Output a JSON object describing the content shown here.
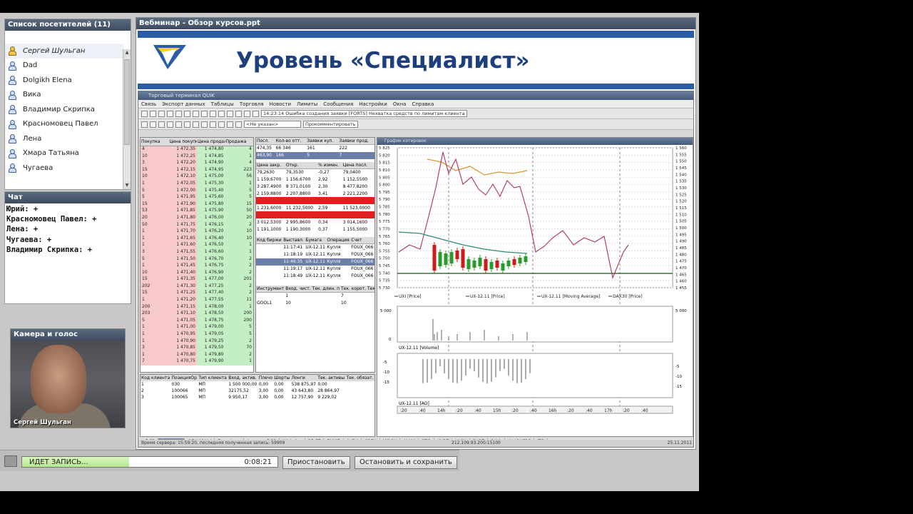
{
  "attendees": {
    "title": "Список посетителей (11)",
    "items": [
      "Сергей Шульган",
      "Dad",
      "Dolgikh Elena",
      "Вика",
      "Владимир Скрипка",
      "Красномовец Павел",
      "Лена",
      "Хмара Татьяна",
      "Чугаева"
    ]
  },
  "chat": {
    "title": "Чат",
    "lines": [
      "Юрий: +",
      "Красномовец Павел: +",
      "Лена: +",
      "Чугаева: +",
      "Владимир Скрипка: +"
    ]
  },
  "camera": {
    "title": "Камера и голос",
    "name": "Сергей Шульган"
  },
  "slide": {
    "window_title": "Вебминар - Обзор курсов.ppt",
    "title": "Уровень «Специалист»",
    "brand_color": "#2a5da3",
    "title_color": "#1d3f7d"
  },
  "app": {
    "menu": [
      "Связь",
      "Экспорт данных",
      "Таблицы",
      "Торговля",
      "Новости",
      "Лимиты",
      "Сообщения",
      "Настройки",
      "Окна",
      "Справка"
    ],
    "toolbar_text": "14:23:14 Ошибка создания заявки [FORTS] Нехватка средств по лимитам клиента",
    "toolbar_field": "<Не указан>",
    "toolbar_field2": "Прокомментировать",
    "orderbook_headers": [
      "Покупка",
      "Цена покупки",
      "Цена продажи",
      "Продажа"
    ],
    "orderbook_rows": [
      [
        "4",
        "1 472,35",
        "1 474,80",
        "4"
      ],
      [
        "10",
        "1 472,25",
        "1 474,85",
        "1"
      ],
      [
        "3",
        "1 472,20",
        "1 474,90",
        "4"
      ],
      [
        "15",
        "1 472,15",
        "1 474,95",
        "223"
      ],
      [
        "10",
        "1 472,10",
        "1 475,00",
        "56"
      ],
      [
        "1",
        "1 472,05",
        "1 475,30",
        "1"
      ],
      [
        "5",
        "1 472,00",
        "1 475,40",
        "5"
      ],
      [
        "5",
        "1 471,95",
        "1 475,60",
        "5"
      ],
      [
        "15",
        "1 471,90",
        "1 475,80",
        "15"
      ],
      [
        "53",
        "1 471,85",
        "1 475,90",
        "50"
      ],
      [
        "20",
        "1 471,80",
        "1 476,00",
        "20"
      ],
      [
        "50",
        "1 471,75",
        "1 476,15",
        "2"
      ],
      [
        "1",
        "1 471,70",
        "1 476,20",
        "10"
      ],
      [
        "1",
        "1 471,65",
        "1 476,40",
        "10"
      ],
      [
        "1",
        "1 471,60",
        "1 476,50",
        "1"
      ],
      [
        "3",
        "1 471,55",
        "1 476,60",
        "1"
      ],
      [
        "5",
        "1 471,50",
        "1 476,70",
        "2"
      ],
      [
        "1",
        "1 471,45",
        "1 476,75",
        "2"
      ],
      [
        "10",
        "1 471,40",
        "1 476,90",
        "2"
      ],
      [
        "15",
        "1 471,35",
        "1 477,00",
        "201"
      ],
      [
        "202",
        "1 471,30",
        "1 477,25",
        "2"
      ],
      [
        "15",
        "1 471,25",
        "1 477,40",
        "2"
      ],
      [
        "1",
        "1 471,20",
        "1 477,55",
        "11"
      ],
      [
        "200",
        "1 471,15",
        "1 478,00",
        "1"
      ],
      [
        "203",
        "1 471,10",
        "1 478,50",
        "200"
      ],
      [
        "5",
        "1 471,05",
        "1 478,75",
        "200"
      ],
      [
        "1",
        "1 471,00",
        "1 479,00",
        "5"
      ],
      [
        "1",
        "1 470,95",
        "1 479,05",
        "5"
      ],
      [
        "1",
        "1 470,90",
        "1 479,25",
        "2"
      ],
      [
        "3",
        "1 470,85",
        "1 479,50",
        "70"
      ],
      [
        "1",
        "1 470,80",
        "1 479,80",
        "2"
      ],
      [
        "7",
        "1 470,75",
        "1 479,90",
        "1"
      ]
    ],
    "mid_table1_headers": [
      "Посл.",
      "Кол-во отт.",
      "Заявки куп.",
      "Заявки прод."
    ],
    "mid_table1_rows": [
      [
        "474,35",
        "66 346",
        "161",
        "222"
      ],
      [
        "463,90",
        "166",
        "5",
        "7"
      ]
    ],
    "mid_table2_headers": [
      "Цена закр.",
      "Откр.",
      "% измен.",
      "Цена посл."
    ],
    "mid_table2_rows": [
      [
        "79,2630",
        "79,3530",
        "-0,27",
        "79,0400"
      ],
      [
        "1 159,6700",
        "1 156,6700",
        "2,92",
        "1 152,5500"
      ],
      [
        "3 287,4900",
        "8 371,0100",
        "2,30",
        "8 477,8200"
      ],
      [
        "2 159,8800",
        "2 207,8800",
        "3,41",
        "2 221,2200"
      ],
      [
        "",
        "",
        "",
        ""
      ],
      [
        "1 231,6000",
        "11 232,5000",
        "2,59",
        "11 523,0000"
      ],
      [
        "",
        "",
        "",
        ""
      ],
      [
        "3 012,5300",
        "2 995,8600",
        "0,34",
        "3 014,1600"
      ],
      [
        "1 191,1000",
        "1 190,3000",
        "0,37",
        "1 155,5000"
      ]
    ],
    "mid_table3_headers": [
      "Код биржи",
      "Выставл.",
      "Бумага",
      "Операция",
      "Счет"
    ],
    "mid_table3_rows": [
      [
        "",
        "11:17:41",
        "UX-12.11",
        "Купля",
        "FOUX_066"
      ],
      [
        "",
        "11:18:19",
        "UX-12.11",
        "Купля",
        "FOUX_066"
      ],
      [
        "",
        "11:46:35",
        "UX-12.11",
        "Купля",
        "FOUX_066"
      ],
      [
        "",
        "11:19:17",
        "UX-12.11",
        "Купля",
        "FOUX_066"
      ],
      [
        "",
        "11:18:49",
        "UX-12.11",
        "Купля",
        "FOUX_066"
      ]
    ],
    "mid_table4_headers": [
      "Инструмент",
      "Вход. чист.",
      "Тек. длин. п",
      "Тек. корот.",
      "Тек."
    ],
    "mid_table4_rows": [
      [
        "",
        "1",
        "",
        "7",
        ""
      ],
      [
        "GOOL1",
        "10",
        "",
        "10",
        ""
      ]
    ],
    "bottom_headers": [
      "Код клиента",
      "ПозицияОр",
      "Тип клиента",
      "Вход. актив.",
      "Плечо",
      "Шорты",
      "Лонги",
      "Тек. активы",
      "Тек. обязат."
    ],
    "bottom_rows": [
      [
        "1",
        "030",
        "МП",
        "1 500 000,00",
        "0,00",
        "0,00",
        "538 875,97",
        "0,00"
      ],
      [
        "2",
        "100066",
        "МП",
        "32175,52",
        "3,00",
        "0,00",
        "43 643,80",
        "28 864,97"
      ],
      [
        "3",
        "100065",
        "МП",
        "9 950,17",
        "3,00",
        "0,00",
        "12 757,90",
        "9 229,02"
      ]
    ],
    "tabs": [
      "oБ РЗ",
      "Фьючерс",
      "ОПЦИОНЫ",
      "Портфель",
      "Анализ об РЗ",
      "UX index",
      "RB PT",
      "EMMZ",
      "AVDK",
      "CBEN",
      "MSICH",
      "ALMK",
      "STIR",
      "KVBZ",
      "YASK",
      "SVGZ",
      "BAVL",
      "ФЬЮЧЕРС",
      "ITG"
    ],
    "status_left": "Время сервера: 15:59:20, последняя полученная запись: 59909",
    "status_mid": "212.109.93.200:15100",
    "status_right": "25.11.2011"
  },
  "chart": {
    "price_labels_left": [
      "5 825",
      "5 820",
      "5 815",
      "5 810",
      "5 805",
      "5 800",
      "5 795",
      "5 790",
      "5 785",
      "5 780",
      "5 775",
      "5 770",
      "5 765",
      "5 760",
      "5 755",
      "5 750",
      "5 745",
      "5 740",
      "5 735",
      "5 730"
    ],
    "price_labels_right": [
      "1 560",
      "1 555",
      "1 550",
      "1 545",
      "1 540",
      "1 535",
      "1 530",
      "1 525",
      "1 520",
      "1 515",
      "1 510",
      "1 505",
      "1 500",
      "1 495",
      "1 490",
      "1 485",
      "1 480",
      "1 475",
      "1 470",
      "1 465",
      "1 460",
      "1 455"
    ],
    "legend": [
      "UXI [Price]",
      "UX-12.11 [Price]",
      "UX-12.11 [Moving Average]",
      "DAX30 [Price]"
    ],
    "volume_label": "UX-12.11 [Volume]",
    "volume_axis": [
      "5 000",
      "0"
    ],
    "ao_label": "UX-12.11 [AO]",
    "ao_axis": [
      "-5",
      "-10",
      "-15"
    ],
    "ao_axis_left": [
      "-5",
      "-10",
      "-15"
    ],
    "time_labels": [
      ":20",
      ":40",
      "14h",
      ":20",
      ":40",
      "15h",
      ":20",
      ":40",
      "16h",
      ":20",
      ":40",
      "17h",
      ":20",
      ":40"
    ],
    "colors": {
      "uxi": "#d99a30",
      "dax": "#b03060",
      "ma": "#2e8b7a",
      "up": "#2a9a2a",
      "down": "#cc1a1a"
    }
  },
  "recording": {
    "label": "ИДЕТ ЗАПИСЬ...",
    "time": "0:08:21",
    "progress": 0.42,
    "pause_label": "Приостановить",
    "stop_label": "Остановить и сохранить"
  }
}
